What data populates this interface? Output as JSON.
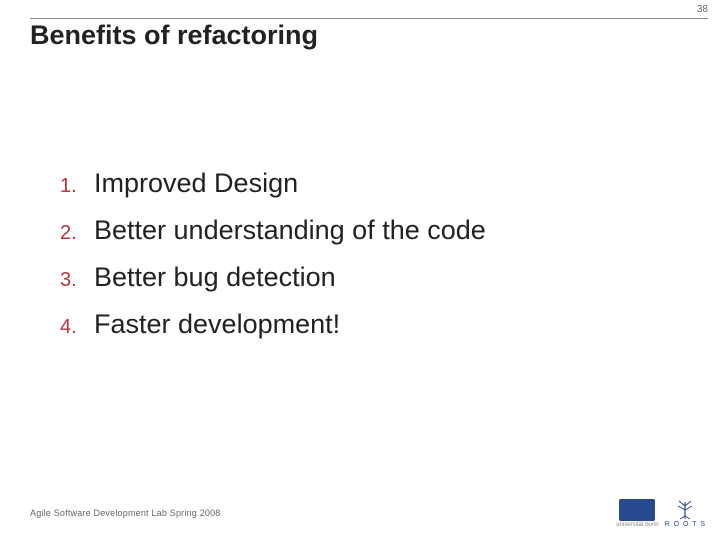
{
  "page_number": "38",
  "title": "Benefits of refactoring",
  "items": [
    {
      "num": "1.",
      "text": "Improved Design"
    },
    {
      "num": "2.",
      "text": "Better understanding of the code"
    },
    {
      "num": "3.",
      "text": "Better bug detection"
    },
    {
      "num": "4.",
      "text": "Faster development!"
    }
  ],
  "footer": "Agile Software Development Lab Spring 2008",
  "logo": {
    "uni_sub": "universität bonn",
    "roots": "R O O T S"
  }
}
